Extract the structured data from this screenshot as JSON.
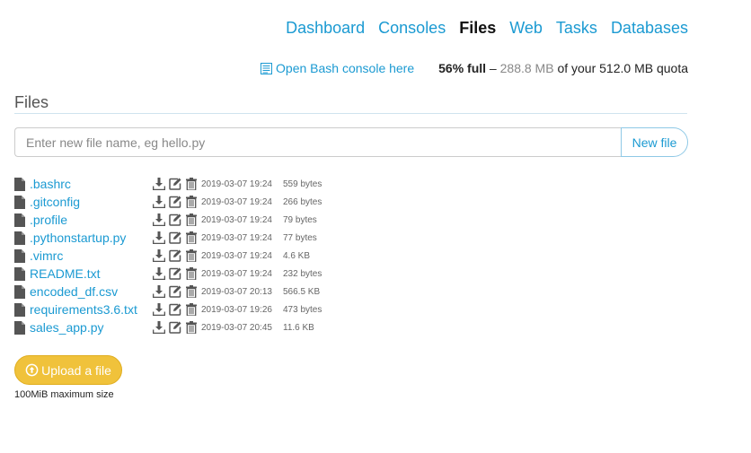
{
  "nav": {
    "items": [
      {
        "label": "Dashboard",
        "active": false
      },
      {
        "label": "Consoles",
        "active": false
      },
      {
        "label": "Files",
        "active": true
      },
      {
        "label": "Web",
        "active": false
      },
      {
        "label": "Tasks",
        "active": false
      },
      {
        "label": "Databases",
        "active": false
      }
    ]
  },
  "header": {
    "bash_link": "Open Bash console here",
    "quota_pct": "56% full",
    "quota_dash": " – ",
    "quota_used": "288.8 MB",
    "quota_rest": " of your 512.0 MB quota"
  },
  "section": {
    "title": "Files"
  },
  "newfile": {
    "placeholder": "Enter new file name, eg hello.py",
    "button": "New file"
  },
  "files": [
    {
      "name": ".bashrc",
      "date": "2019-03-07 19:24",
      "size": "559 bytes"
    },
    {
      "name": ".gitconfig",
      "date": "2019-03-07 19:24",
      "size": "266 bytes"
    },
    {
      "name": ".profile",
      "date": "2019-03-07 19:24",
      "size": "79 bytes"
    },
    {
      "name": ".pythonstartup.py",
      "date": "2019-03-07 19:24",
      "size": "77 bytes"
    },
    {
      "name": ".vimrc",
      "date": "2019-03-07 19:24",
      "size": "4.6 KB"
    },
    {
      "name": "README.txt",
      "date": "2019-03-07 19:24",
      "size": "232 bytes"
    },
    {
      "name": "encoded_df.csv",
      "date": "2019-03-07 20:13",
      "size": "566.5 KB"
    },
    {
      "name": "requirements3.6.txt",
      "date": "2019-03-07 19:26",
      "size": "473 bytes"
    },
    {
      "name": "sales_app.py",
      "date": "2019-03-07 20:45",
      "size": "11.6 KB"
    }
  ],
  "upload": {
    "label": "Upload a file",
    "note": "100MiB maximum size"
  },
  "colors": {
    "link": "#1b9ad2",
    "upload": "#f0c23b",
    "icon": "#555555"
  }
}
